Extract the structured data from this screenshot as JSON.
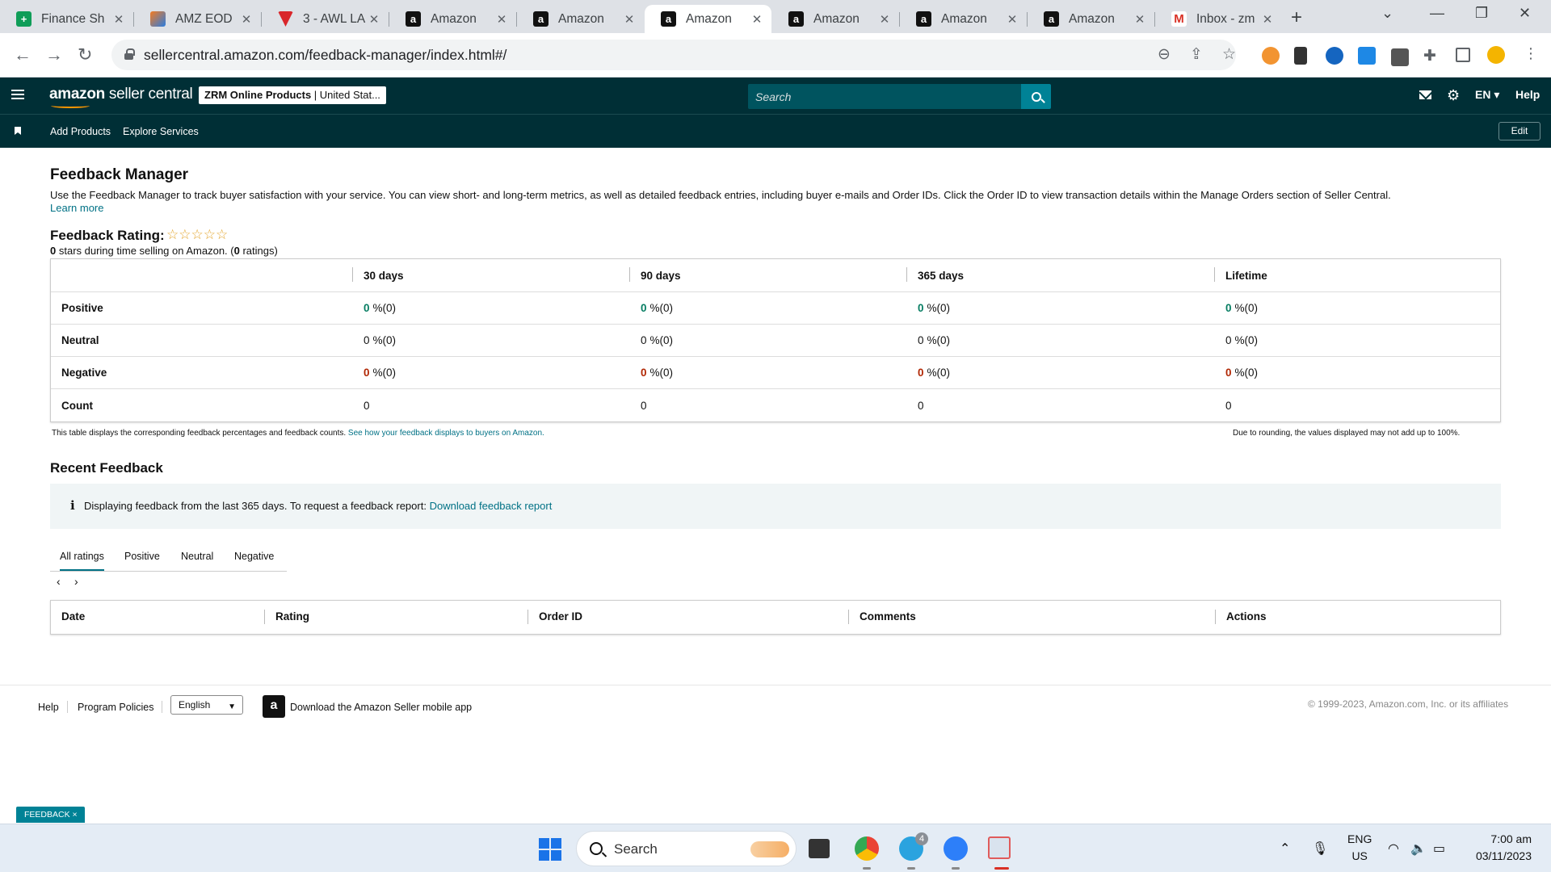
{
  "browser": {
    "tabs": [
      {
        "label": "Finance Sh",
        "icon": "sheets-icon"
      },
      {
        "label": "AMZ EOD",
        "icon": "amz-icon"
      },
      {
        "label": "3 - AWL LA",
        "icon": "awl-icon"
      },
      {
        "label": "Amazon",
        "icon": "amazon-icon"
      },
      {
        "label": "Amazon",
        "icon": "amazon-icon"
      },
      {
        "label": "Amazon",
        "icon": "amazon-icon",
        "active": true
      },
      {
        "label": "Amazon",
        "icon": "amazon-icon"
      },
      {
        "label": "Amazon",
        "icon": "amazon-icon"
      },
      {
        "label": "Amazon",
        "icon": "amazon-icon"
      },
      {
        "label": "Inbox - zm",
        "icon": "gmail-icon"
      }
    ],
    "url": "sellercentral.amazon.com/feedback-manager/index.html#/"
  },
  "header": {
    "logo_main": "amazon",
    "logo_sub": " seller central",
    "store_name": "ZRM Online Products",
    "store_region": " | United Stat...",
    "search_placeholder": "Search",
    "language": "EN ▾",
    "help": "Help"
  },
  "subnav": {
    "links": [
      "Add Products",
      "Explore Services"
    ],
    "edit": "Edit"
  },
  "page": {
    "title": "Feedback Manager",
    "intro": "Use the Feedback Manager to track buyer satisfaction with your service. You can view short- and long-term metrics, as well as detailed feedback entries, including buyer e-mails and Order IDs. Click the Order ID to view transaction details within the Manage Orders section of Seller Central.",
    "learn_more": "Learn more",
    "rating_title": "Feedback Rating:",
    "stars": "☆☆☆☆☆",
    "rating_bold": "0",
    "rating_mid": " stars during time selling on Amazon. (",
    "rating_count": "0",
    "rating_tail": " ratings)"
  },
  "feedback_table": {
    "columns": [
      "30 days",
      "90 days",
      "365 days",
      "Lifetime"
    ],
    "rows": [
      {
        "label": "Positive",
        "values": [
          "0",
          "0",
          "0",
          "0"
        ],
        "suffix": "%(0)",
        "tone": "positive"
      },
      {
        "label": "Neutral",
        "values": [
          "0",
          "0",
          "0",
          "0"
        ],
        "suffix": "%(0)",
        "tone": "neutral"
      },
      {
        "label": "Negative",
        "values": [
          "0",
          "0",
          "0",
          "0"
        ],
        "suffix": "%(0)",
        "tone": "negative"
      },
      {
        "label": "Count",
        "values": [
          "0",
          "0",
          "0",
          "0"
        ],
        "suffix": "",
        "tone": "count"
      }
    ],
    "note": "This table displays the corresponding feedback percentages and feedback counts.",
    "note_link": "See how your feedback displays to buyers on Amazon.",
    "rounding_note": "Due to rounding, the values displayed may not add up to 100%."
  },
  "recent": {
    "title": "Recent Feedback",
    "info_text": "Displaying feedback from the last 365 days. To request a feedback report:",
    "info_link": "Download feedback report",
    "tabs": [
      "All ratings",
      "Positive",
      "Neutral",
      "Negative"
    ],
    "columns": [
      "Date",
      "Rating",
      "Order ID",
      "Comments",
      "Actions"
    ]
  },
  "footer": {
    "help": "Help",
    "policies": "Program Policies",
    "language": "English",
    "app_text": "Download the Amazon Seller mobile app",
    "copyright": "© 1999-2023, Amazon.com, Inc. or its affiliates",
    "feedback_tab": "FEEDBACK ×"
  },
  "taskbar": {
    "search": "Search",
    "lang_top": "ENG",
    "lang_bottom": "US",
    "time": "7:00 am",
    "date": "03/11/2023",
    "telegram_badge": "4"
  },
  "colors": {
    "header_bg": "#002f36",
    "accent": "#008296",
    "link": "#007185",
    "positive": "#067d62",
    "negative": "#b12704",
    "star": "#e3a52d"
  }
}
